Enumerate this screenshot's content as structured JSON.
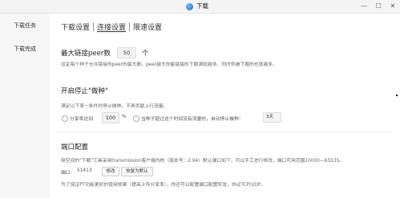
{
  "window": {
    "title": "下载",
    "controls": {
      "minimize": "—",
      "maximize": "☐",
      "close": "✕"
    }
  },
  "sidebar": {
    "items": [
      {
        "label": "下载任务"
      },
      {
        "label": "下载完成"
      }
    ]
  },
  "tabs": [
    {
      "label": "下载设置",
      "active": false
    },
    {
      "label": "连接设置",
      "active": true
    },
    {
      "label": "限速设置",
      "active": false
    }
  ],
  "max_peers": {
    "title_prefix": "最大链接peer数",
    "value": "50",
    "unit": "个",
    "desc": "设定每个种子允许链接的peer的最大数。peer越大你能链接的下载源就越多，同时你被下载的也就越多。"
  },
  "seeding": {
    "title": "开启停止\"做种\"",
    "desc": "满足以下某一条件时停止做种，不再贡献上行流量。",
    "ratio_label": "分享率达到",
    "ratio_value": "100",
    "ratio_unit": "%",
    "time_label": "当种子超过这个时间没有流量时，自动停止做种：",
    "time_value": "3天"
  },
  "port": {
    "title": "端口配置",
    "desc": "极空间的\"下载\"工具采用transmission客户端内核（版本号：2.94）默认端口如下，可以手工进行修改，端口可用范围10000—65535。",
    "port_label": "端口：",
    "port_value": "51413",
    "modify_label": "修改",
    "reset_label": "恢复为默认",
    "note": "为了保证PT功能更好的使用效果（提高上传分享率），你还可以配置端口配置转发，协议TCP/UDP。"
  }
}
